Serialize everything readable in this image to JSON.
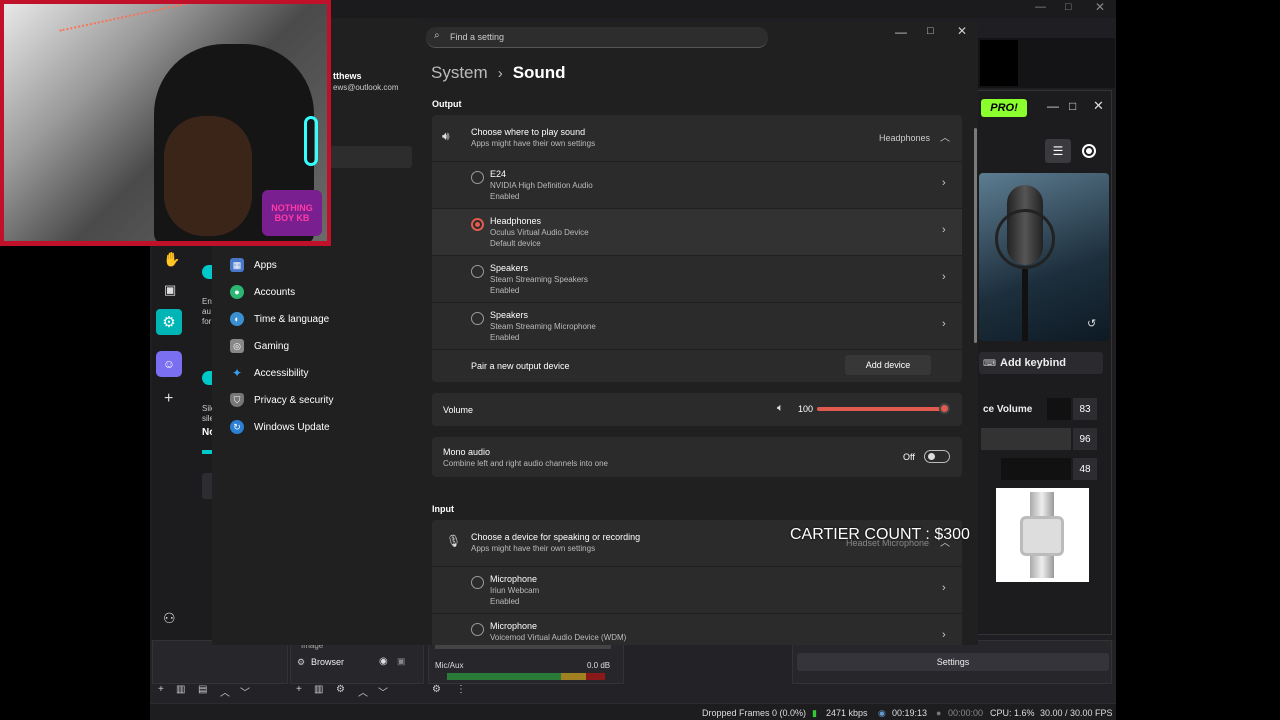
{
  "settings": {
    "search_placeholder": "Find a setting",
    "breadcrumb_parent": "System",
    "breadcrumb_sep": "›",
    "page_title": "Sound",
    "output_heading": "Output",
    "output_choose_title": "Choose where to play sound",
    "output_choose_sub": "Apps might have their own settings",
    "output_selected": "Headphones",
    "devices": [
      {
        "name": "E24",
        "driver": "NVIDIA High Definition Audio",
        "status": "Enabled"
      },
      {
        "name": "Headphones",
        "driver": "Oculus Virtual Audio Device",
        "status": "Default device"
      },
      {
        "name": "Speakers",
        "driver": "Steam Streaming Speakers",
        "status": "Enabled"
      },
      {
        "name": "Speakers",
        "driver": "Steam Streaming Microphone",
        "status": "Enabled"
      }
    ],
    "pair_label": "Pair a new output device",
    "add_device_label": "Add device",
    "volume_label": "Volume",
    "volume_value": "100",
    "volume_fraction": 1.0,
    "mono_title": "Mono audio",
    "mono_sub": "Combine left and right audio channels into one",
    "mono_state": "Off",
    "input_heading": "Input",
    "input_choose_title": "Choose a device for speaking or recording",
    "input_choose_sub": "Apps might have their own settings",
    "input_selected": "Headset Microphone",
    "input_devices": [
      {
        "name": "Microphone",
        "driver": "Iriun Webcam",
        "status": "Enabled"
      },
      {
        "name": "Microphone",
        "driver": "Voicemod Virtual Audio Device (WDM)",
        "status": ""
      }
    ],
    "user_name": "tthews",
    "user_email": "ews@outlook.com",
    "nav": [
      "Apps",
      "Accounts",
      "Time & language",
      "Gaming",
      "Accessibility",
      "Privacy & security",
      "Windows Update"
    ],
    "partial_texts": [
      "Ena",
      "au",
      "for",
      "Sile",
      "sile",
      "No"
    ]
  },
  "overlay": {
    "cartier_text": "CARTIER COUNT : $300",
    "webcam_badge": "NOTHING BOY KB"
  },
  "plugin": {
    "pro_badge": "PRO!",
    "add_keybind": "Add keybind",
    "voice_volume_label": "ce Volume",
    "values": [
      "83",
      "96",
      "48"
    ]
  },
  "obs": {
    "sources": [
      "Image",
      "Browser"
    ],
    "mixer_track": "Mic/Aux",
    "mixer_db": "0.0 dB",
    "settings_button": "Settings",
    "status": {
      "dropped": "Dropped Frames 0 (0.0%)",
      "kbps": "2471 kbps",
      "live_time": "00:19:13",
      "rec_time": "00:00:00",
      "cpu": "CPU: 1.6%",
      "fps": "30.00 / 30.00 FPS"
    }
  },
  "colors": {
    "accent_teal": "#00c8c8",
    "slider_red": "#e05a4e",
    "pro_green": "#8bff2e"
  }
}
